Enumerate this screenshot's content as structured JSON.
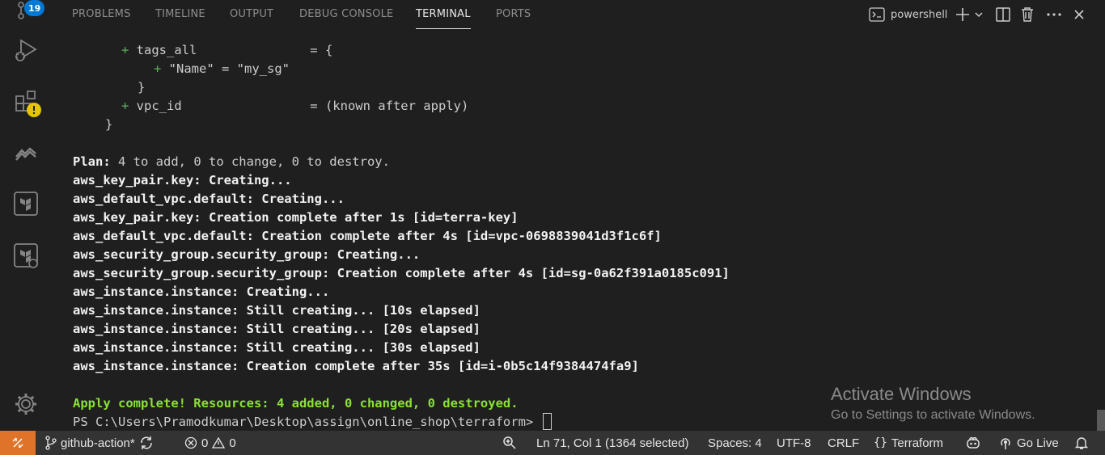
{
  "activity_bar": {
    "accounts_badge": "19",
    "icons": [
      "source-control-icon",
      "run-debug-icon",
      "extensions-icon",
      "terraform-cloud-icon",
      "terraform-icon",
      "terraform-alt-icon",
      "settings-gear-icon"
    ]
  },
  "panel": {
    "tabs": [
      "PROBLEMS",
      "TIMELINE",
      "OUTPUT",
      "DEBUG CONSOLE",
      "TERMINAL",
      "PORTS"
    ],
    "active_tab": "TERMINAL",
    "shell_label": "powershell"
  },
  "terminal": {
    "lines": {
      "l1_plus": "+",
      "l1_text": " tags_all               = {",
      "l2_plus": "+",
      "l2_text": " \"Name\" = \"my_sg\"",
      "l3_text": "}",
      "l4_plus": "+",
      "l4_text": " vpc_id                 = (known after apply)",
      "l5_text": "}",
      "plan_label": "Plan:",
      "plan_text": " 4 to add, 0 to change, 0 to destroy.",
      "o1": "aws_key_pair.key: Creating...",
      "o2": "aws_default_vpc.default: Creating...",
      "o3": "aws_key_pair.key: Creation complete after 1s [id=terra-key]",
      "o4": "aws_default_vpc.default: Creation complete after 4s [id=vpc-0698839041d3f1c6f]",
      "o5": "aws_security_group.security_group: Creating...",
      "o6": "aws_security_group.security_group: Creation complete after 4s [id=sg-0a62f391a0185c091]",
      "o7": "aws_instance.instance: Creating...",
      "o8": "aws_instance.instance: Still creating... [10s elapsed]",
      "o9": "aws_instance.instance: Still creating... [20s elapsed]",
      "o10": "aws_instance.instance: Still creating... [30s elapsed]",
      "o11": "aws_instance.instance: Creation complete after 35s [id=i-0b5c14f9384474fa9]",
      "apply": "Apply complete! Resources: 4 added, 0 changed, 0 destroyed.",
      "prompt": "PS C:\\Users\\Pramodkumar\\Desktop\\assign\\online_shop\\terraform> "
    }
  },
  "watermark": {
    "title": "Activate Windows",
    "subtitle": "Go to Settings to activate Windows."
  },
  "status_bar": {
    "branch": "github-action*",
    "errors": "0",
    "warnings": "0",
    "cursor_position": "Ln 71, Col 1 (1364 selected)",
    "indentation": "Spaces: 4",
    "encoding": "UTF-8",
    "eol": "CRLF",
    "language": "Terraform",
    "go_live": "Go Live"
  },
  "colors": {
    "background": "#1f1f1f",
    "status_bar": "#333333",
    "remote_button": "#e0732a",
    "plus_sign": "#5faf5f",
    "apply_green": "#8ae234",
    "badge_blue": "#0078d4"
  }
}
